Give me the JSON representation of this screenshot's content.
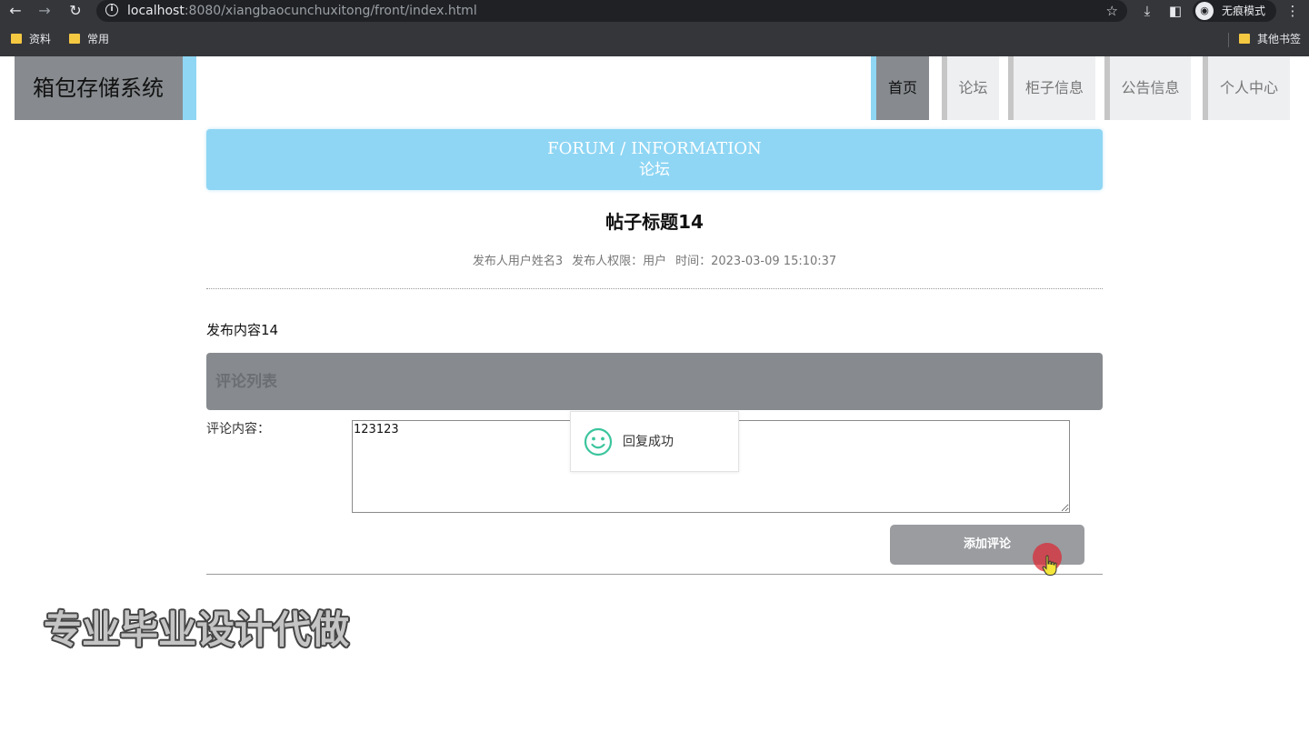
{
  "browser": {
    "url_host": "localhost",
    "url_path": ":8080/xiangbaocunchuxitong/front/index.html",
    "incognito_label": "无痕模式",
    "bookmarks": [
      "资料",
      "常用"
    ],
    "other_bookmarks": "其他书签"
  },
  "header": {
    "logo": "箱包存储系统",
    "nav": [
      {
        "label": "首页",
        "active": true
      },
      {
        "label": "论坛",
        "active": false
      },
      {
        "label": "柜子信息",
        "active": false
      },
      {
        "label": "公告信息",
        "active": false
      },
      {
        "label": "个人中心",
        "active": false
      }
    ]
  },
  "banner": {
    "en": "FORUM / INFORMATION",
    "cn": "论坛"
  },
  "post": {
    "title": "帖子标题14",
    "author": "发布人用户姓名3",
    "role": "发布人权限：用户",
    "time": "时间：2023-03-09 15:10:37",
    "content": "发布内容14"
  },
  "comments": {
    "header": "评论列表",
    "label": "评论内容：",
    "value": "123123",
    "submit": "添加评论"
  },
  "toast": {
    "message": "回复成功",
    "icon": "smile-icon"
  },
  "watermark": "专业毕业设计代做",
  "colors": {
    "accent_blue": "#8fd6f4",
    "nav_active": "#878b8f",
    "nav_bg": "#eeeff1",
    "button": "#9a9ca0",
    "toast_icon": "#3cc59d"
  }
}
